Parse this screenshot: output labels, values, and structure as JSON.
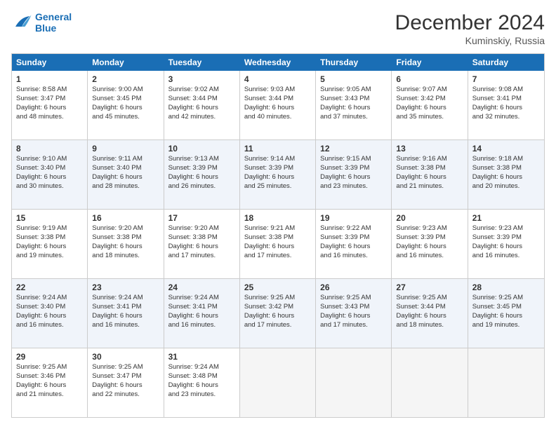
{
  "header": {
    "logo_general": "General",
    "logo_blue": "Blue",
    "title": "December 2024",
    "subtitle": "Kuminskiy, Russia"
  },
  "days": [
    "Sunday",
    "Monday",
    "Tuesday",
    "Wednesday",
    "Thursday",
    "Friday",
    "Saturday"
  ],
  "weeks": [
    [
      {
        "day": "1",
        "lines": [
          "Sunrise: 8:58 AM",
          "Sunset: 3:47 PM",
          "Daylight: 6 hours",
          "and 48 minutes."
        ]
      },
      {
        "day": "2",
        "lines": [
          "Sunrise: 9:00 AM",
          "Sunset: 3:45 PM",
          "Daylight: 6 hours",
          "and 45 minutes."
        ]
      },
      {
        "day": "3",
        "lines": [
          "Sunrise: 9:02 AM",
          "Sunset: 3:44 PM",
          "Daylight: 6 hours",
          "and 42 minutes."
        ]
      },
      {
        "day": "4",
        "lines": [
          "Sunrise: 9:03 AM",
          "Sunset: 3:44 PM",
          "Daylight: 6 hours",
          "and 40 minutes."
        ]
      },
      {
        "day": "5",
        "lines": [
          "Sunrise: 9:05 AM",
          "Sunset: 3:43 PM",
          "Daylight: 6 hours",
          "and 37 minutes."
        ]
      },
      {
        "day": "6",
        "lines": [
          "Sunrise: 9:07 AM",
          "Sunset: 3:42 PM",
          "Daylight: 6 hours",
          "and 35 minutes."
        ]
      },
      {
        "day": "7",
        "lines": [
          "Sunrise: 9:08 AM",
          "Sunset: 3:41 PM",
          "Daylight: 6 hours",
          "and 32 minutes."
        ]
      }
    ],
    [
      {
        "day": "8",
        "lines": [
          "Sunrise: 9:10 AM",
          "Sunset: 3:40 PM",
          "Daylight: 6 hours",
          "and 30 minutes."
        ]
      },
      {
        "day": "9",
        "lines": [
          "Sunrise: 9:11 AM",
          "Sunset: 3:40 PM",
          "Daylight: 6 hours",
          "and 28 minutes."
        ]
      },
      {
        "day": "10",
        "lines": [
          "Sunrise: 9:13 AM",
          "Sunset: 3:39 PM",
          "Daylight: 6 hours",
          "and 26 minutes."
        ]
      },
      {
        "day": "11",
        "lines": [
          "Sunrise: 9:14 AM",
          "Sunset: 3:39 PM",
          "Daylight: 6 hours",
          "and 25 minutes."
        ]
      },
      {
        "day": "12",
        "lines": [
          "Sunrise: 9:15 AM",
          "Sunset: 3:39 PM",
          "Daylight: 6 hours",
          "and 23 minutes."
        ]
      },
      {
        "day": "13",
        "lines": [
          "Sunrise: 9:16 AM",
          "Sunset: 3:38 PM",
          "Daylight: 6 hours",
          "and 21 minutes."
        ]
      },
      {
        "day": "14",
        "lines": [
          "Sunrise: 9:18 AM",
          "Sunset: 3:38 PM",
          "Daylight: 6 hours",
          "and 20 minutes."
        ]
      }
    ],
    [
      {
        "day": "15",
        "lines": [
          "Sunrise: 9:19 AM",
          "Sunset: 3:38 PM",
          "Daylight: 6 hours",
          "and 19 minutes."
        ]
      },
      {
        "day": "16",
        "lines": [
          "Sunrise: 9:20 AM",
          "Sunset: 3:38 PM",
          "Daylight: 6 hours",
          "and 18 minutes."
        ]
      },
      {
        "day": "17",
        "lines": [
          "Sunrise: 9:20 AM",
          "Sunset: 3:38 PM",
          "Daylight: 6 hours",
          "and 17 minutes."
        ]
      },
      {
        "day": "18",
        "lines": [
          "Sunrise: 9:21 AM",
          "Sunset: 3:38 PM",
          "Daylight: 6 hours",
          "and 17 minutes."
        ]
      },
      {
        "day": "19",
        "lines": [
          "Sunrise: 9:22 AM",
          "Sunset: 3:39 PM",
          "Daylight: 6 hours",
          "and 16 minutes."
        ]
      },
      {
        "day": "20",
        "lines": [
          "Sunrise: 9:23 AM",
          "Sunset: 3:39 PM",
          "Daylight: 6 hours",
          "and 16 minutes."
        ]
      },
      {
        "day": "21",
        "lines": [
          "Sunrise: 9:23 AM",
          "Sunset: 3:39 PM",
          "Daylight: 6 hours",
          "and 16 minutes."
        ]
      }
    ],
    [
      {
        "day": "22",
        "lines": [
          "Sunrise: 9:24 AM",
          "Sunset: 3:40 PM",
          "Daylight: 6 hours",
          "and 16 minutes."
        ]
      },
      {
        "day": "23",
        "lines": [
          "Sunrise: 9:24 AM",
          "Sunset: 3:41 PM",
          "Daylight: 6 hours",
          "and 16 minutes."
        ]
      },
      {
        "day": "24",
        "lines": [
          "Sunrise: 9:24 AM",
          "Sunset: 3:41 PM",
          "Daylight: 6 hours",
          "and 16 minutes."
        ]
      },
      {
        "day": "25",
        "lines": [
          "Sunrise: 9:25 AM",
          "Sunset: 3:42 PM",
          "Daylight: 6 hours",
          "and 17 minutes."
        ]
      },
      {
        "day": "26",
        "lines": [
          "Sunrise: 9:25 AM",
          "Sunset: 3:43 PM",
          "Daylight: 6 hours",
          "and 17 minutes."
        ]
      },
      {
        "day": "27",
        "lines": [
          "Sunrise: 9:25 AM",
          "Sunset: 3:44 PM",
          "Daylight: 6 hours",
          "and 18 minutes."
        ]
      },
      {
        "day": "28",
        "lines": [
          "Sunrise: 9:25 AM",
          "Sunset: 3:45 PM",
          "Daylight: 6 hours",
          "and 19 minutes."
        ]
      }
    ],
    [
      {
        "day": "29",
        "lines": [
          "Sunrise: 9:25 AM",
          "Sunset: 3:46 PM",
          "Daylight: 6 hours",
          "and 21 minutes."
        ]
      },
      {
        "day": "30",
        "lines": [
          "Sunrise: 9:25 AM",
          "Sunset: 3:47 PM",
          "Daylight: 6 hours",
          "and 22 minutes."
        ]
      },
      {
        "day": "31",
        "lines": [
          "Sunrise: 9:24 AM",
          "Sunset: 3:48 PM",
          "Daylight: 6 hours",
          "and 23 minutes."
        ]
      },
      null,
      null,
      null,
      null
    ]
  ]
}
